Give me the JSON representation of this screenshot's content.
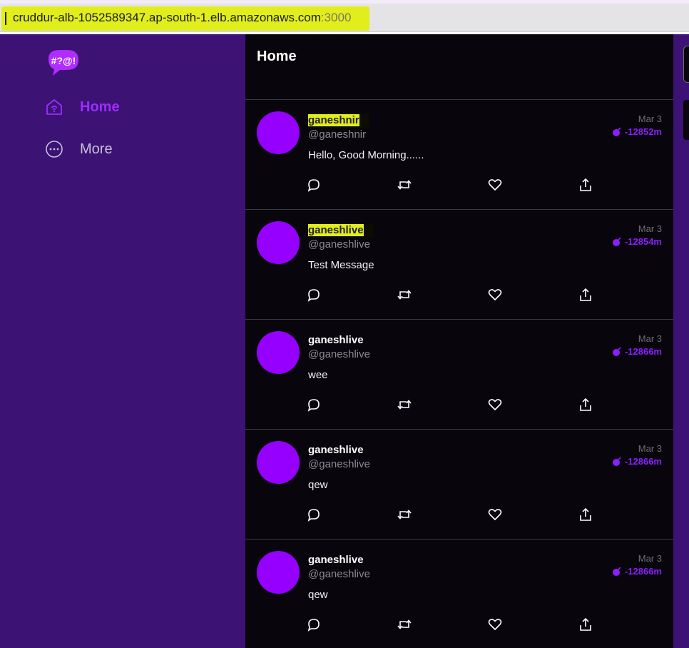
{
  "browser": {
    "url_host": "cruddur-alb-1052589347.ap-south-1.elb.amazonaws.com",
    "url_port": ":3000"
  },
  "sidebar": {
    "logo_text": "#?@!",
    "items": [
      {
        "label": "Home",
        "icon": "home-icon",
        "active": true
      },
      {
        "label": "More",
        "icon": "more-icon",
        "active": false
      }
    ]
  },
  "feed": {
    "title": "Home",
    "posts": [
      {
        "display_name": "ganeshnir",
        "handle": "@ganeshnir",
        "message": "Hello, Good Morning......",
        "date": "Mar 3",
        "expiry": "-12852m",
        "highlighted": true
      },
      {
        "display_name": "ganeshlive",
        "handle": "@ganeshlive",
        "message": "Test Message",
        "date": "Mar 3",
        "expiry": "-12854m",
        "highlighted": true
      },
      {
        "display_name": "ganeshlive",
        "handle": "@ganeshlive",
        "message": "wee",
        "date": "Mar 3",
        "expiry": "-12866m",
        "highlighted": false
      },
      {
        "display_name": "ganeshlive",
        "handle": "@ganeshlive",
        "message": "qew",
        "date": "Mar 3",
        "expiry": "-12866m",
        "highlighted": false
      },
      {
        "display_name": "ganeshlive",
        "handle": "@ganeshlive",
        "message": "qew",
        "date": "Mar 3",
        "expiry": "-12866m",
        "highlighted": false
      }
    ]
  },
  "colors": {
    "sidebar_bg": "#3d1275",
    "feed_bg": "#08050c",
    "accent": "#9500ff",
    "highlight": "#e2ed1c"
  }
}
